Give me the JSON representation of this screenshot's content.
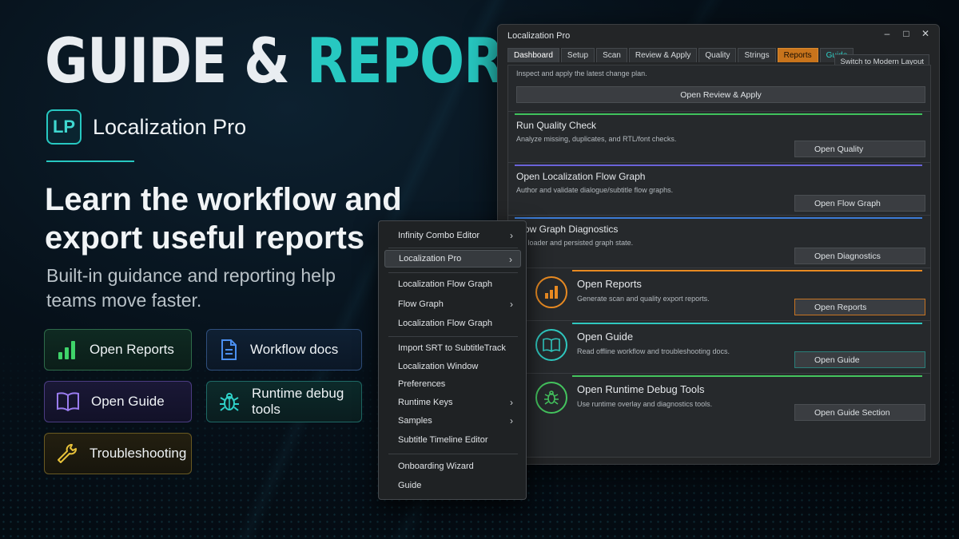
{
  "hero": {
    "title_white": "GUIDE &",
    "title_teal": "REPORTS",
    "brand_logo": "LP",
    "brand_name": "Localization Pro",
    "headline": "Learn the workflow and export useful reports",
    "subline": "Built-in guidance and reporting help teams move faster."
  },
  "features": {
    "open_reports": "Open Reports",
    "workflow_docs": "Workflow docs",
    "open_guide": "Open Guide",
    "runtime_debug": "Runtime debug tools",
    "troubleshooting": "Troubleshooting"
  },
  "window": {
    "title": "Localization Pro",
    "controls": [
      "–",
      "□",
      "✕"
    ],
    "tabs": [
      "Dashboard",
      "Setup",
      "Scan",
      "Review & Apply",
      "Quality",
      "Strings",
      "Reports",
      "Guide"
    ],
    "active_tab": "Reports",
    "modern_layout": "Switch to Modern Layout"
  },
  "panels": {
    "review": {
      "desc": "Inspect and apply the latest change plan.",
      "button": "Open Review & Apply"
    },
    "quality": {
      "title": "Run Quality Check",
      "desc": "Analyze missing, duplicates, and RTL/font checks.",
      "button": "Open Quality",
      "accent": "#3fc25c"
    },
    "flow_graph": {
      "title": "Open Localization Flow Graph",
      "desc": "Author and validate dialogue/subtitle flow graphs.",
      "button": "Open Flow Graph",
      "accent": "#6a63d8"
    },
    "diagnostics": {
      "title": "Flow Graph Diagnostics",
      "desc": "ect loader and persisted graph state.",
      "button": "Open Diagnostics",
      "accent": "#3b7bd6"
    },
    "reports": {
      "title": "Open Reports",
      "desc": "Generate scan and quality export reports.",
      "button": "Open Reports",
      "accent": "#e88a22",
      "icon": "bar-chart-icon"
    },
    "guide": {
      "title": "Open Guide",
      "desc": "Read offline workflow and troubleshooting docs.",
      "button": "Open Guide",
      "accent": "#2fc7bf",
      "icon": "book-icon"
    },
    "debug": {
      "title": "Open Runtime Debug Tools",
      "desc": "Use runtime overlay and diagnostics tools.",
      "button": "Open Guide Section",
      "accent": "#44c45e",
      "icon": "bug-icon"
    }
  },
  "menu": {
    "infinity_combo": "Infinity Combo Editor",
    "localization_pro": "Localization Pro",
    "loc_flow_graph_1": "Localization Flow Graph",
    "flow_graph": "Flow Graph",
    "loc_flow_graph_2": "Localization Flow Graph",
    "import_srt": "Import SRT to SubtitleTrack",
    "loc_window": "Localization Window",
    "preferences": "Preferences",
    "runtime_keys": "Runtime Keys",
    "samples": "Samples",
    "subtitle_timeline": "Subtitle Timeline Editor",
    "onboarding": "Onboarding Wizard",
    "guide": "Guide"
  }
}
